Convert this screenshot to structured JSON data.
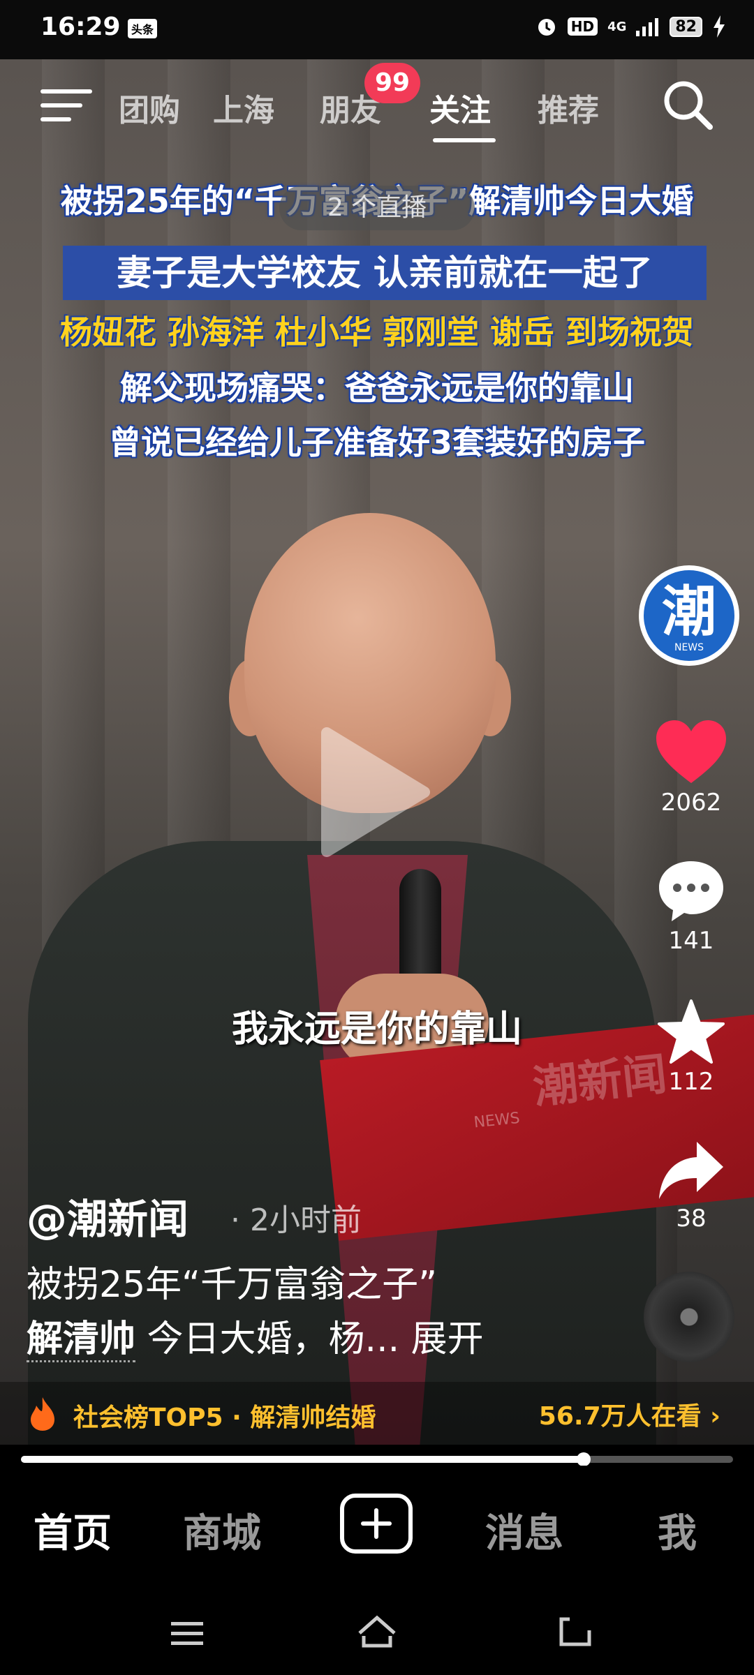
{
  "status_bar": {
    "time": "16:29",
    "app_badge": "头条",
    "hd": "HD",
    "network": "4G",
    "battery": "82"
  },
  "top_nav": {
    "tabs": [
      {
        "label": "团购"
      },
      {
        "label": "上海"
      },
      {
        "label": "朋友"
      },
      {
        "label": "关注"
      },
      {
        "label": "推荐"
      }
    ],
    "active_tab": "关注",
    "friends_badge": "99"
  },
  "video": {
    "live_pill": "2 个直播",
    "headline_1": "被拐25年的“千万富翁之子”解清帅今日大婚",
    "headline_2": "妻子是大学校友 认亲前就在一起了",
    "headline_3": "杨妞花 孙海洋 杜小华 郭刚堂 谢岳 到场祝贺",
    "headline_4": "解父现场痛哭：爸爸永远是你的靠山",
    "headline_5": "曾说已经给儿子准备好3套装好的房子",
    "subtitle": "我永远是你的靠山",
    "watermark": "潮新闻",
    "watermark_sub": "NEWS"
  },
  "side_rail": {
    "avatar_char": "潮",
    "avatar_sub": "NEWS",
    "likes": "2062",
    "comments": "141",
    "favorites": "112",
    "shares": "38"
  },
  "post": {
    "author": "@潮新闻",
    "time_ago": "2小时前",
    "caption_line1": "被拐25年“千万富翁之子”",
    "caption_bold": "解清帅",
    "caption_line2": "今日大婚，杨... 展开"
  },
  "trend": {
    "label": "社会榜TOP5 · 解清帅结婚",
    "watching": "56.7万人在看 ›"
  },
  "playback": {
    "progress": 0.79
  },
  "bottom_nav": {
    "home": "首页",
    "mall": "商城",
    "messages": "消息",
    "me": "我"
  },
  "colors": {
    "badge_red": "#f23b57",
    "like_red": "#fe2c55",
    "trend_gold": "#ffc02e",
    "headline_blue": "#2c4ea7"
  }
}
